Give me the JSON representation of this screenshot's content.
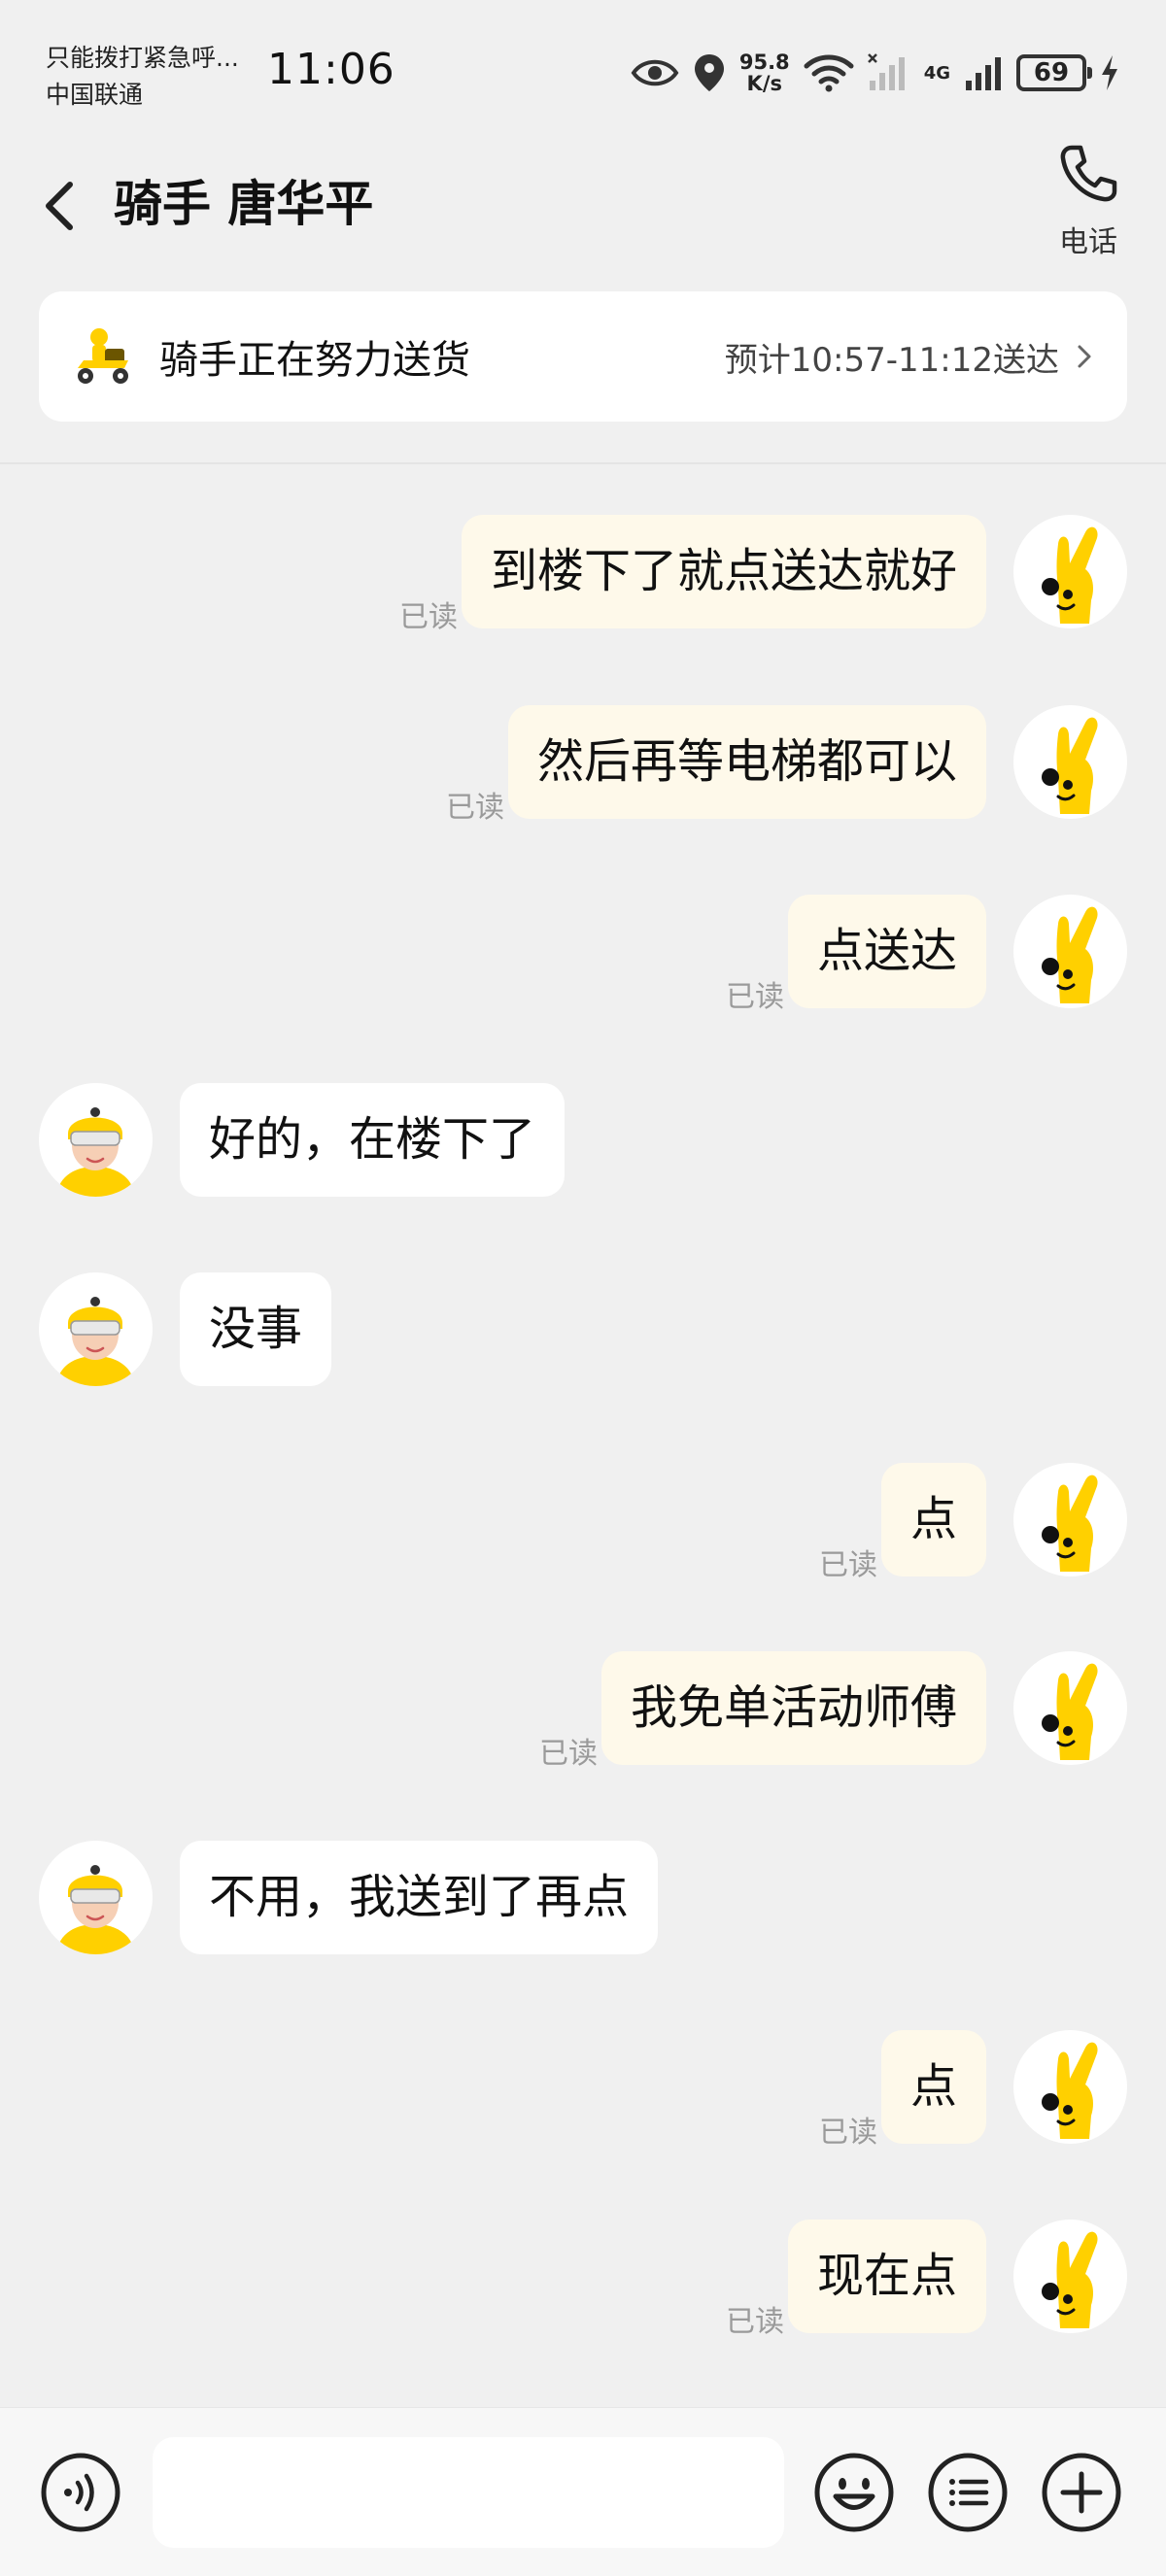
{
  "status_bar": {
    "emergency_text": "只能拨打紧急呼...",
    "carrier": "中国联通",
    "time": "11:06",
    "net_speed_value": "95.8",
    "net_speed_unit": "K/s",
    "network_type": "4G",
    "battery": "69",
    "icons": [
      "eye-icon",
      "location-icon",
      "wifi-icon",
      "signal-icon",
      "charging-icon"
    ]
  },
  "header": {
    "title": "骑手 唐华平",
    "phone_label": "电话",
    "icons": [
      "back-arrow-icon",
      "phone-icon"
    ]
  },
  "delivery_card": {
    "status": "骑手正在努力送货",
    "eta": "预计10:57-11:12送达",
    "icons": [
      "rider-scooter-icon",
      "chevron-right-icon"
    ]
  },
  "read_label": "已读",
  "messages": [
    {
      "side": "right",
      "text": "到楼下了就点送达就好",
      "read": "已读"
    },
    {
      "side": "right",
      "text": "然后再等电梯都可以",
      "read": "已读"
    },
    {
      "side": "right",
      "text": "点送达",
      "read": "已读"
    },
    {
      "side": "left",
      "text": "好的，在楼下了"
    },
    {
      "side": "left",
      "text": "没事"
    },
    {
      "side": "right",
      "text": "点",
      "read": "已读"
    },
    {
      "side": "right",
      "text": "我免单活动师傅",
      "read": "已读"
    },
    {
      "side": "left",
      "text": "不用，我送到了再点"
    },
    {
      "side": "right",
      "text": "点",
      "read": "已读"
    },
    {
      "side": "right",
      "text": "现在点",
      "read": "已读"
    }
  ],
  "input_bar": {
    "placeholder": "",
    "icons": [
      "voice-icon",
      "emoji-icon",
      "quick-reply-icon",
      "plus-icon"
    ]
  },
  "colors": {
    "background": "#f0f0f0",
    "my_bubble": "#fef9ea",
    "rider_bubble": "#ffffff",
    "brand_yellow": "#ffd000",
    "read_gray": "#9a9a9a"
  }
}
